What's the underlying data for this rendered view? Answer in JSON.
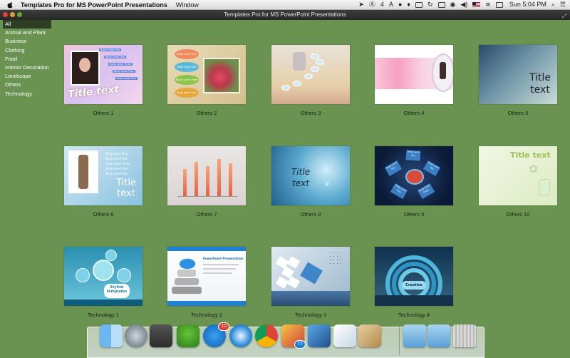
{
  "menubar": {
    "app_name": "Templates Pro for MS PowerPoint Presentations",
    "items": [
      "Window"
    ],
    "status": {
      "count_badge": "4",
      "clock": "Sun 5:04 PM"
    }
  },
  "window": {
    "title": "Templates Pro for MS PowerPoint Presentations"
  },
  "sidebar": {
    "categories": [
      {
        "label": "All",
        "active": true
      },
      {
        "label": "Animal and Plant"
      },
      {
        "label": "Business"
      },
      {
        "label": "Clothing"
      },
      {
        "label": "Food"
      },
      {
        "label": "Interior Decoration"
      },
      {
        "label": "Landscape"
      },
      {
        "label": "Others"
      },
      {
        "label": "Technology"
      }
    ]
  },
  "templates": [
    {
      "label": "Others 1",
      "thumb_title": "Title text",
      "levels": [
        "Body Level One",
        "Body Level Two",
        "Body Level Three",
        "Body Level Four",
        "Body Level Five"
      ]
    },
    {
      "label": "Others 2",
      "levels": [
        "Body Level One",
        "Body Level Two",
        "Body Level Three",
        "Body Level Four"
      ]
    },
    {
      "label": "Others 3"
    },
    {
      "label": "Others 4"
    },
    {
      "label": "Others 5",
      "thumb_title": "Title text"
    },
    {
      "label": "Others 6",
      "thumb_title": "Title text",
      "levels": [
        "Body Level One",
        "Body Level Two",
        "Body Level Three",
        "Body Level Four",
        "Body Level Five"
      ]
    },
    {
      "label": "Others 7"
    },
    {
      "label": "Others 8",
      "thumb_title": "Title text"
    },
    {
      "label": "Others 9",
      "levels": [
        "Body Level One",
        "Body Level Two",
        "Body Level Three",
        "Body Level Four",
        "Body Level Five"
      ]
    },
    {
      "label": "Others 10",
      "thumb_title": "Title text"
    },
    {
      "label": "Technology 1",
      "thumb_title": "Stylish templates"
    },
    {
      "label": "Technology 2",
      "thumb_title": "PowerPoint Presentation"
    },
    {
      "label": "Technology 3"
    },
    {
      "label": "Technology 4",
      "thumb_title": "Creative"
    }
  ],
  "dock": {
    "app_store_badge": "10",
    "calendar_badge": "77"
  },
  "colors": {
    "background": "#6a9250",
    "sidebar_active": "#2d3e22"
  }
}
